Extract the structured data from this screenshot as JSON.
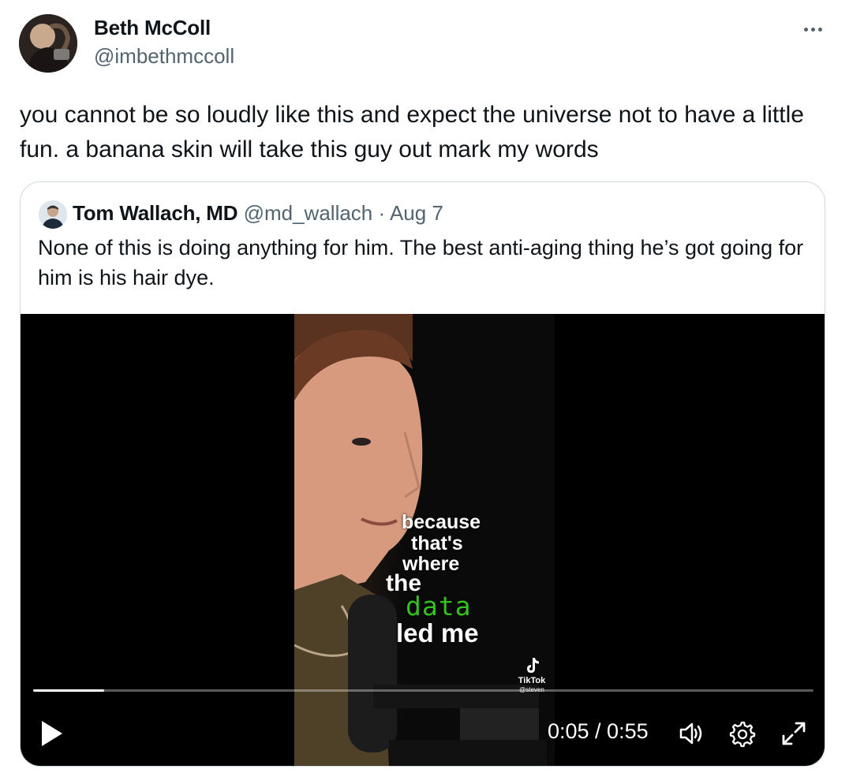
{
  "tweet": {
    "author": {
      "name": "Beth McColl",
      "handle": "@imbethmccoll"
    },
    "more_icon": "more-horizontal-icon",
    "text": "you cannot be so loudly like this and expect the universe not to have a little fun. a banana skin will take this guy out mark my words"
  },
  "quote": {
    "author": {
      "name": "Tom Wallach, MD",
      "handle": "@md_wallach"
    },
    "separator": "·",
    "date": "Aug 7",
    "text": "None of this is doing anything for him.  The best anti-aging thing he’s got going for him is his hair dye.",
    "video": {
      "captions": {
        "line1": "because",
        "line2": "that's",
        "line3": "where",
        "line4": "the",
        "line5": "data",
        "line6": "led me"
      },
      "caption_highlight_color": "#35c21f",
      "watermark": {
        "brand": "TikTok",
        "user": "@steven"
      },
      "time_display": "0:05 / 0:55",
      "progress_fraction": 0.0909,
      "controls": {
        "play_icon": "play-icon",
        "volume_icon": "volume-icon",
        "settings_icon": "gear-icon",
        "fullscreen_icon": "fullscreen-icon"
      }
    }
  },
  "colors": {
    "text_primary": "#0f1419",
    "text_secondary": "#536471",
    "card_border": "#cfd9de",
    "video_background": "#000000"
  }
}
